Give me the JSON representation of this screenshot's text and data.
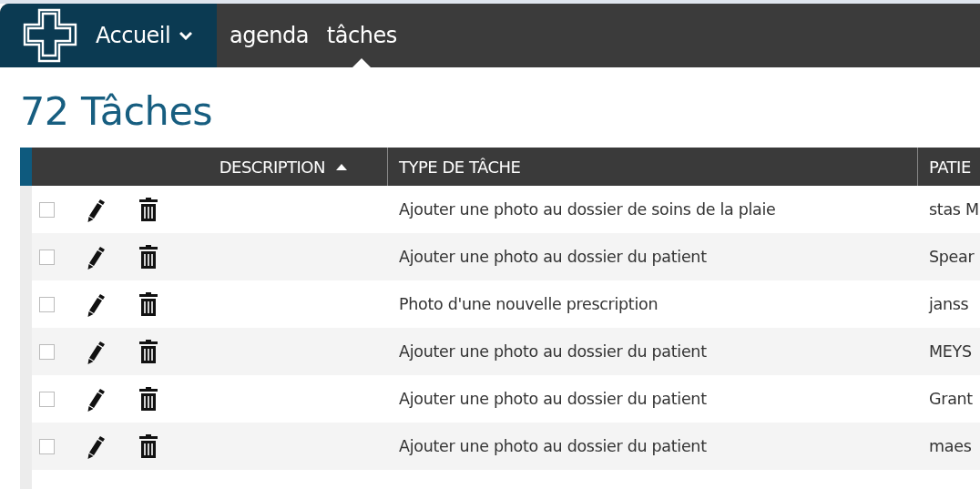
{
  "nav": {
    "home": {
      "label": "Accueil",
      "has_menu": true
    },
    "items": [
      {
        "label": "agenda",
        "selected": false
      },
      {
        "label": "tâches",
        "selected": true
      }
    ]
  },
  "heading": "72 Tâches",
  "table": {
    "columns": [
      {
        "label": "DESCRIPTION",
        "sorted": true
      },
      {
        "label": "TYPE DE TÂCHE",
        "sorted": false
      },
      {
        "label": "PATIE",
        "sorted": false
      }
    ],
    "rows": [
      {
        "checked": false,
        "type": "Ajouter une photo au dossier de soins de la plaie",
        "patient": "stas M"
      },
      {
        "checked": false,
        "type": "Ajouter une photo au dossier du patient",
        "patient": "Spear"
      },
      {
        "checked": false,
        "type": "Photo d'une nouvelle prescription",
        "patient": "janss"
      },
      {
        "checked": false,
        "type": "Ajouter une photo au dossier du patient",
        "patient": "MEYS"
      },
      {
        "checked": false,
        "type": "Ajouter une photo au dossier du patient",
        "patient": "Grant"
      },
      {
        "checked": false,
        "type": "Ajouter une photo au dossier du patient",
        "patient": "maes"
      }
    ]
  }
}
